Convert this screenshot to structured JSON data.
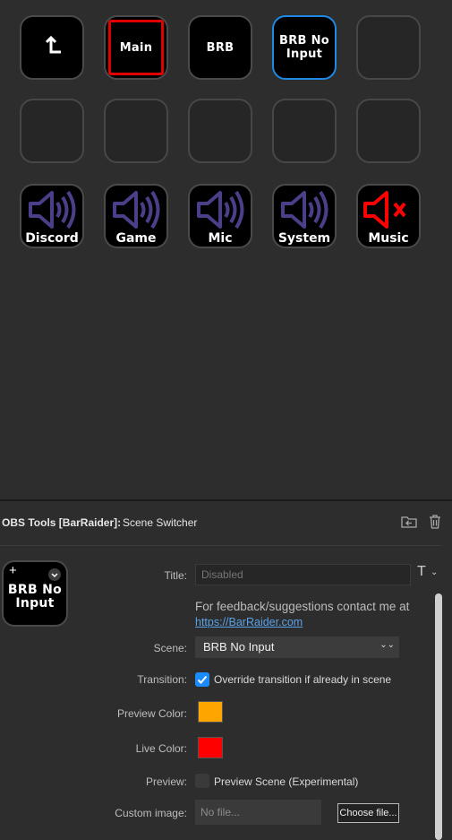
{
  "grid": {
    "row1": [
      {
        "type": "back",
        "label": ""
      },
      {
        "type": "scene",
        "label": "Main"
      },
      {
        "type": "scene",
        "label": "BRB"
      },
      {
        "type": "scene",
        "label": "BRB No\nInput"
      },
      {
        "type": "empty",
        "label": ""
      }
    ],
    "row3": [
      {
        "label": "Discord",
        "muted": false
      },
      {
        "label": "Game",
        "muted": false
      },
      {
        "label": "Mic",
        "muted": false
      },
      {
        "label": "System",
        "muted": false
      },
      {
        "label": "Music",
        "muted": true
      }
    ]
  },
  "header": {
    "plugin": "OBS Tools [BarRaider]:",
    "action": "Scene Switcher"
  },
  "preview_key": {
    "label": "BRB No\nInput"
  },
  "form": {
    "title_label": "Title:",
    "title_placeholder": "Disabled",
    "feedback": "For feedback/suggestions contact me at",
    "link": "https://BarRaider.com",
    "scene_label": "Scene:",
    "scene_value": "BRB No Input",
    "transition_label": "Transition:",
    "transition_option": "Override transition if already in scene",
    "transition_checked": true,
    "preview_color_label": "Preview Color:",
    "preview_color": "#ffa500",
    "live_color_label": "Live Color:",
    "live_color": "#ff0000",
    "preview_label": "Preview:",
    "preview_option": "Preview Scene (Experimental)",
    "preview_checked": false,
    "custom_image_label": "Custom image:",
    "file_value": "No file...",
    "choose_button": "Choose file..."
  },
  "colors": {
    "selected_border": "#1e88e5",
    "audio_icon": "#4b3f8a",
    "muted_icon": "#ff0000",
    "link": "#5aa2e8"
  }
}
